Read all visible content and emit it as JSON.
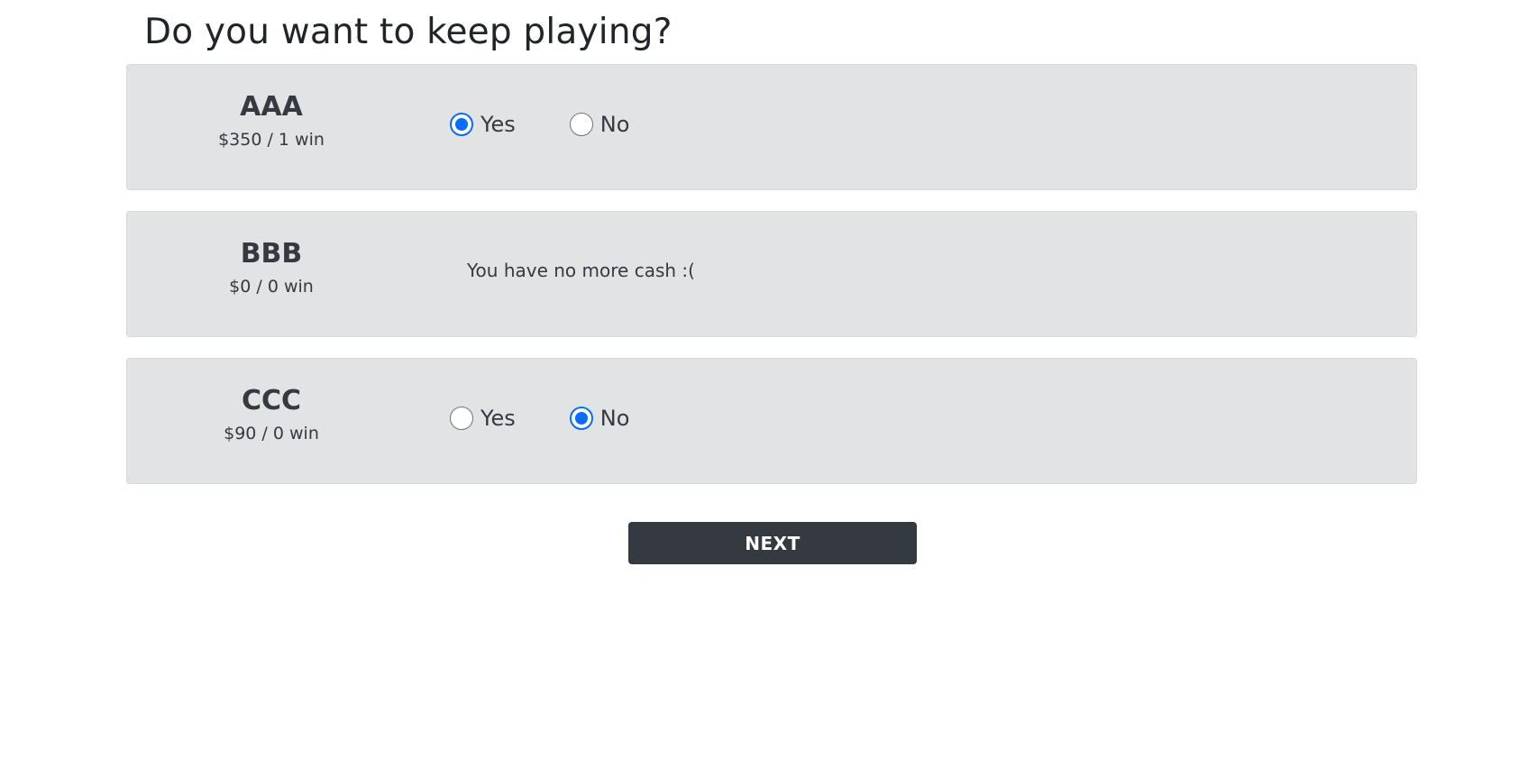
{
  "page": {
    "title": "Do you want to keep playing?"
  },
  "players": [
    {
      "name": "AAA",
      "stats": "$350 / 1 win",
      "yes_label": "Yes",
      "no_label": "No",
      "selected": "Yes"
    },
    {
      "name": "BBB",
      "stats": "$0 / 0 win",
      "message": "You have no more cash :("
    },
    {
      "name": "CCC",
      "stats": "$90 / 0 win",
      "yes_label": "Yes",
      "no_label": "No",
      "selected": "No"
    }
  ],
  "actions": {
    "next_label": "NEXT"
  },
  "colors": {
    "card_background": "#e2e3e5",
    "radio_selected": "#0a6cff",
    "button_background": "#343a40"
  }
}
